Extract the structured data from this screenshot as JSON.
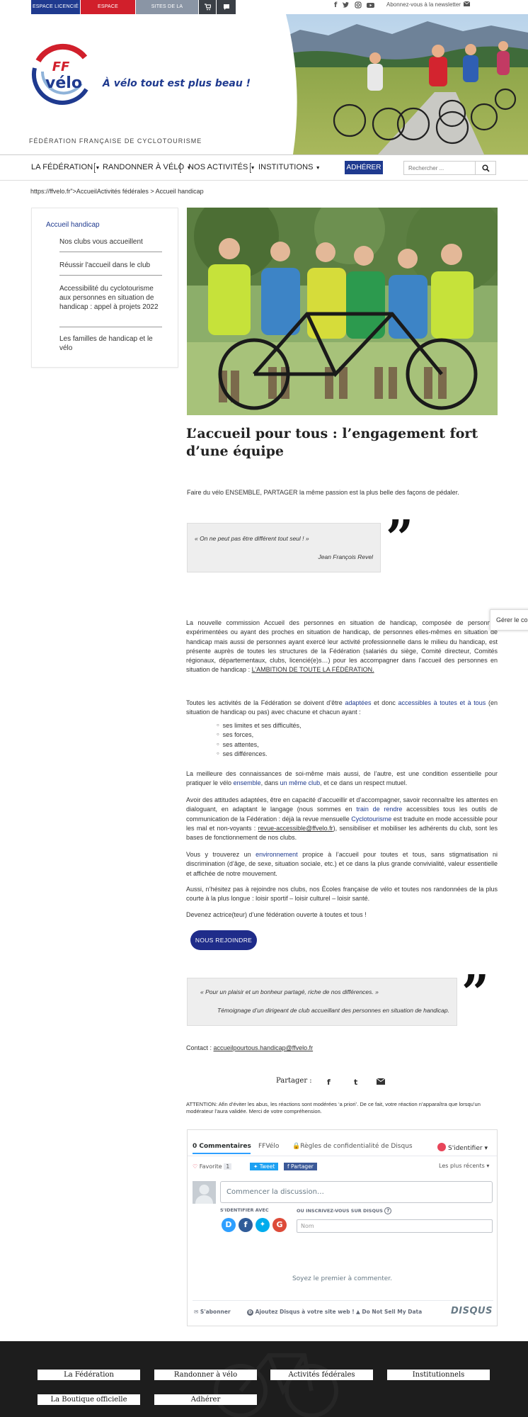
{
  "topbar": {
    "espace_licencie": "ESPACE LICENCIÉ",
    "espace_structures": "ESPACE STRUCTURES",
    "sites": "SITES DE LA FÉDÉRATION ▾",
    "newsletter": "Abonnez-vous à la newsletter",
    "colors": {
      "licencie": "#1f3a8f",
      "structures": "#d11f2b",
      "sites": "#8a95a5",
      "dark": "#3a3f46"
    }
  },
  "header": {
    "logo_top": "FF",
    "logo_bottom": "vélo",
    "slogan": "À vélo tout est plus beau !",
    "federation_name": "FÉDÉRATION FRANÇAISE DE CYCLOTOURISME"
  },
  "nav": {
    "items": [
      "LA FÉDÉRATION",
      "RANDONNER À VÉLO",
      "NOS ACTIVITÉS",
      "INSTITUTIONS"
    ],
    "adherer": "ADHÉRER",
    "search_placeholder": "Rechercher ..."
  },
  "breadcrumb": "https://ffvelo.fr\">AccueilActivités fédérales > Accueil handicap",
  "sidebar": {
    "title": "Accueil handicap",
    "items": [
      "Nos clubs vous accueillent",
      "Réussir l'accueil dans le club",
      "Accessibilité du cyclotourisme aux personnes en situation de handicap : appel à projets 2022",
      "Les familles de handicap et le vélo"
    ]
  },
  "article": {
    "title": "L’accueil pour tous : l’engagement fort d’une équipe",
    "intro": "Faire du vélo ENSEMBLE, PARTAGER la même passion est la plus belle des façons de pédaler.",
    "quote1": {
      "text": "« On ne peut pas être différent tout seul ! »",
      "author": "Jean François Revel"
    },
    "p1": "La nouvelle commission Accueil des personnes en situation de handicap, composée de personnes expérimentées ou ayant des proches en situation de handicap, de personnes elles-mêmes en situation de handicap mais aussi de personnes ayant exercé leur activité professionnelle dans le milieu du handicap, est présente auprès de toutes les structures de la Fédération (salariés du siège, Comité directeur, Comités régionaux, départementaux, clubs, licencié(e)s…) pour les accompagner dans l’accueil des personnes en situation de handicap :",
    "p1_link": "L’AMBITION DE TOUTE LA FÉDÉRATION.",
    "p2_a": "Toutes les activités de la Fédération se doivent d’être",
    "p2_link1": "adaptées",
    "p2_b": "et donc",
    "p2_link2": "accessibles à toutes et à tous",
    "p2_c": "(en situation de handicap ou pas) avec chacune et chacun ayant :",
    "bullets": [
      "ses limites et ses difficultés,",
      "ses forces,",
      "ses attentes,",
      "ses différences."
    ],
    "p3_a": "La meilleure des connaissances de soi-même mais aussi, de l’autre, est une condition essentielle pour pratiquer le vélo",
    "p3_link1": "ensemble",
    "p3_b": ", dans",
    "p3_link2": "un même club",
    "p3_c": ", et ce dans un respect mutuel.",
    "p4_a": "Avoir des attitudes adaptées, être en capacité d’accueillir et d’accompagner, savoir reconnaître les attentes en dialoguant, en adaptant le langage (nous sommes en",
    "p4_link1": "train de rendre",
    "p4_b": "accessibles tous les outils de communication de la Fédération : déjà la revue mensuelle",
    "p4_link2": "Cyclotourisme",
    "p4_c": "est traduite en mode accessible pour les mal et non-voyants :",
    "p4_link3": "revue-accessible@ffvelo.fr",
    "p4_d": "), sensibiliser et mobiliser les adhérents du club, sont les bases de fonctionnement de nos clubs.",
    "p5_a": "Vous y trouverez un",
    "p5_link": "environnement",
    "p5_b": "propice à l’accueil pour toutes et tous, sans stigmatisation ni discrimination (d’âge, de sexe, situation sociale, etc.) et ce dans la plus grande convivialité, valeur essentielle et affichée de notre mouvement.",
    "p6": "Aussi, n’hésitez pas à rejoindre nos clubs, nos Écoles française de vélo et toutes nos randonnées de la plus courte à la plus longue : loisir sportif – loisir culturel – loisir santé.",
    "p7": "Devenez actrice(teur) d’une fédération ouverte à toutes et tous !",
    "join_button": "NOUS REJOINDRE",
    "quote2": {
      "text": "« Pour un plaisir et un bonheur partagé, riche de nos différences. »",
      "author": "Témoignage d’un dirigeant de club accueillant des personnes en situation de handicap."
    },
    "contact_label": "Contact :",
    "contact_email": "accueilpourtous.handicap@ffvelo.fr",
    "share_label": "Partager :",
    "attention": "ATTENTION: Afin d’éviter les abus, les réactions sont modérées ‘a priori’. De ce fait, votre réaction n’apparaîtra que lorsqu’un modérateur l’aura validée. Merci de votre compréhension."
  },
  "cookie_tab": "Gérer le consentement",
  "disqus": {
    "tab_comments": "0 Commentaires",
    "tab_ffvelo": "FFVélo",
    "privacy": "Règles de confidentialité de Disqus",
    "login": "S'identifier",
    "favorite": "Favorite",
    "favorite_count": "1",
    "tweet": "Tweet",
    "share": "Partager",
    "sort": "Les plus récents",
    "placeholder": "Commencer la discussion…",
    "login_with": "S'IDENTIFIER AVEC",
    "or_register": "OU INSCRIVEZ-VOUS SUR DISQUS",
    "name_placeholder": "Nom",
    "first_comment": "Soyez le premier à commenter.",
    "subscribe": "S'abonner",
    "add_disqus": "Ajoutez Disqus à votre site web !",
    "dnsmd": "Do Not Sell My Data",
    "brand": "DISQUS"
  },
  "footer": {
    "buttons": [
      "La Fédération",
      "Randonner à vélo",
      "Activités fédérales",
      "Institutionnels",
      "La Boutique officielle",
      "Adhérer"
    ]
  }
}
